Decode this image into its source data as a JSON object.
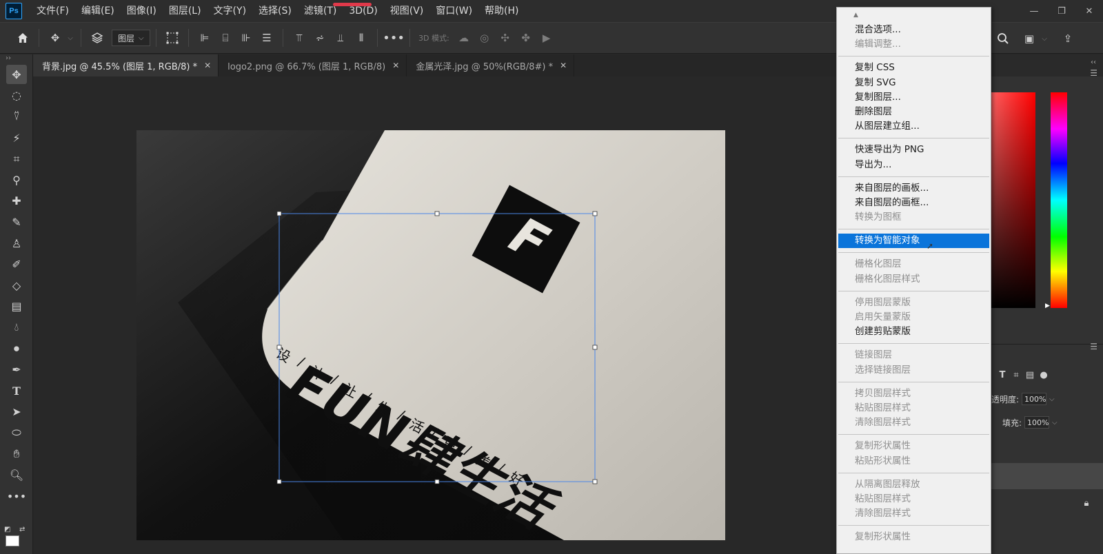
{
  "app": {
    "logo": "Ps",
    "accent_color": "#31a8ff"
  },
  "menubar": {
    "items": [
      "文件(F)",
      "编辑(E)",
      "图像(I)",
      "图层(L)",
      "文字(Y)",
      "选择(S)",
      "滤镜(T)",
      "3D(D)",
      "视图(V)",
      "窗口(W)",
      "帮助(H)"
    ],
    "window_controls": [
      "minimize-icon",
      "restore-icon",
      "close-icon"
    ]
  },
  "options_bar": {
    "layer_select": "图层",
    "mode_3d_label": "3D 模式:"
  },
  "tabs": [
    {
      "label": "背景.jpg @ 45.5% (图层 1, RGB/8) *",
      "active": true
    },
    {
      "label": "logo2.png @ 66.7% (图层 1, RGB/8)",
      "active": false
    },
    {
      "label": "金属光泽.jpg @ 50%(RGB/8#) *",
      "active": false
    }
  ],
  "tools": [
    "move-tool",
    "ellipse-marquee-tool",
    "lasso-tool",
    "magic-wand-tool",
    "crop-tool",
    "eyedropper-tool",
    "healing-brush-tool",
    "brush-tool",
    "clone-stamp-tool",
    "history-brush-tool",
    "eraser-tool",
    "gradient-tool",
    "blur-tool",
    "dodge-tool",
    "pen-tool",
    "type-tool",
    "path-selection-tool",
    "ellipse-shape-tool",
    "hand-tool",
    "zoom-tool",
    "more-tools"
  ],
  "artwork": {
    "brand_wordmark": "FUN肆生活",
    "monogram": "F",
    "tagline_chars": [
      "设",
      "计",
      "让",
      "生",
      "活",
      "更",
      "美",
      "好"
    ]
  },
  "layers_panel": {
    "opacity_label": "透明度:",
    "opacity_value": "100%",
    "fill_label": "填充:",
    "fill_value": "100%"
  },
  "context_menu": {
    "groups": [
      [
        {
          "label": "混合选项...",
          "disabled": false
        },
        {
          "label": "编辑调整...",
          "disabled": true
        }
      ],
      [
        {
          "label": "复制 CSS",
          "disabled": false
        },
        {
          "label": "复制 SVG",
          "disabled": false
        },
        {
          "label": "复制图层...",
          "disabled": false
        },
        {
          "label": "删除图层",
          "disabled": false
        },
        {
          "label": "从图层建立组...",
          "disabled": false
        }
      ],
      [
        {
          "label": "快速导出为 PNG",
          "disabled": false
        },
        {
          "label": "导出为...",
          "disabled": false
        }
      ],
      [
        {
          "label": "来自图层的画板...",
          "disabled": false
        },
        {
          "label": "来自图层的画框...",
          "disabled": false
        },
        {
          "label": "转换为图框",
          "disabled": true
        }
      ],
      [
        {
          "label": "转换为智能对象",
          "disabled": false,
          "highlighted": true
        }
      ],
      [
        {
          "label": "栅格化图层",
          "disabled": true
        },
        {
          "label": "栅格化图层样式",
          "disabled": true
        }
      ],
      [
        {
          "label": "停用图层蒙版",
          "disabled": true
        },
        {
          "label": "启用矢量蒙版",
          "disabled": true
        },
        {
          "label": "创建剪贴蒙版",
          "disabled": false
        }
      ],
      [
        {
          "label": "链接图层",
          "disabled": true
        },
        {
          "label": "选择链接图层",
          "disabled": true
        }
      ],
      [
        {
          "label": "拷贝图层样式",
          "disabled": true
        },
        {
          "label": "粘贴图层样式",
          "disabled": true
        },
        {
          "label": "清除图层样式",
          "disabled": true
        }
      ],
      [
        {
          "label": "复制形状属性",
          "disabled": true
        },
        {
          "label": "粘贴形状属性",
          "disabled": true
        }
      ],
      [
        {
          "label": "从隔离图层释放",
          "disabled": true
        },
        {
          "label": "粘贴图层样式",
          "disabled": true
        },
        {
          "label": "清除图层样式",
          "disabled": true
        }
      ],
      [
        {
          "label": "复制形状属性",
          "disabled": true
        }
      ]
    ],
    "highlight_color": "#0a74da"
  }
}
